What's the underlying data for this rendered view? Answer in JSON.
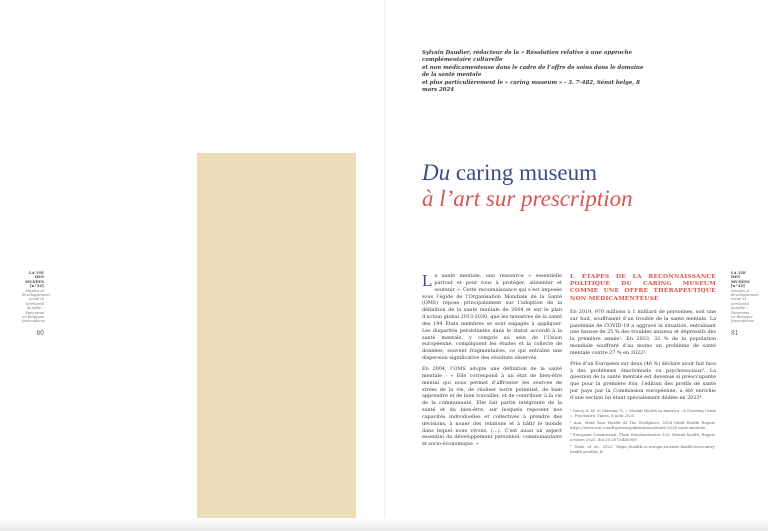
{
  "epigraph": {
    "line1": "Sylvain Daudier, rédacteur de la « Résolution relative à une approche complémentaire culturelle",
    "line2": "et non médicamenteuse dans le cadre de l’offre de soins dans le domaine de la santé mentale",
    "line3": "et plus particulièrement le « caring museum » - 3. 7-482, Sénat belge, 8 mars 2024"
  },
  "title": {
    "word_italic": "Du",
    "line1_rest": " caring museum",
    "line2": "à l’art sur prescription"
  },
  "sidebar_left": {
    "head1": "LA VIE",
    "head2": "DES",
    "head3": "MUSÉES",
    "head4": "[n°32]",
    "sub": "Musées et développement social et territorial durable – Panorama en Belgique francophone",
    "page": "80"
  },
  "sidebar_right": {
    "head1": "LA VIE",
    "head2": "DES",
    "head3": "MUSÉES",
    "head4": "[n°32]",
    "sub": "Musées et développement social et territorial durable – Panorama en Belgique francophone",
    "page": "81"
  },
  "col1": {
    "drop": "L",
    "p1": "a santé mentale, une ressource « essentielle partout et pour tous à protéger, alimenter et soutenir ». Cette reconnaissance qui s’est imposée sous l’égide de l’Organisation Mondiale de la Santé (OMS) repose principalement sur l’adoption de la définition de la santé mentale de 2004 et sur le plan d’action global 2013-2030, que les ministres de la santé des 194 États membres se sont engagés à appliquer. Les disparités persistantes dans le statut accordé à la santé mentale, y compris au sein de l’Union européenne, compliquent les études et la collecte de données, souvent fragmentaires, ce qui entraîne une dispersion significative des résultats observés.",
    "p2": "En 2004, l’OMS adopte une définition de la santé mentale : « Elle correspond à un état de bien-être mental qui nous permet d’affronter les sources de stress de la vie, de réaliser notre potentiel, de bien apprendre et de bien travailler, et de contribuer à la vie de la communauté. Elle fait partie intégrante de la santé et du bien-être, sur lesquels reposent nos capacités individuelles et collectives à prendre des décisions, à nouer des relations et à bâtir le monde dans lequel nous vivons. (…). C’est aussi un aspect essentiel du développement personnel, communautaire et socio-économique. »"
  },
  "col2": {
    "section_head": "I. ÉTAPES DE LA RECONNAISSANCE POLITIQUE DU CARING MUSEUM COMME UNE OFFRE THÉRAPEUTIQUE NON MÉDICAMENTEUSE",
    "p1": "En 2019, 970 millions à 1 milliard de personnes, soit une sur huit, souffraient d’un trouble de la santé mentale. La pandémie de COVID-19 a aggravé la situation, entraînant une hausse de 25 % des troubles anxieux et dépressifs dès la première année¹. En 2023, 32 % de la population mondiale souffrent d’au moins un problème de santé mentale contre 27 % en 2022².",
    "p2": "Près d’un Européen sur deux (46 %) déclare avoir fait face à des problèmes émotionnels ou psychosociaux³. La question de la santé mentale est devenue si préoccupante que pour la première fois, l’édition des profils de santé par pays par la Commission européenne, a été enrichie d’une section lui étant spécialement dédiée en 2023⁴.",
    "fn1": "¹ Darcy A. M. et Mariano T., « Mental Health in America : A Growing Crisis », Psychiatric Times, 8 août 2021.",
    "fn2": "² Aon, Mind Your Health At The Workplace, 2024 Mind Health Report. https://www.aon.com/fr/presse/publications/etude-2024-sante-mentale",
    "fn3": "³ European Commission, Flash Eurobarometer 530, Mental health, Report, octobre 2023, doi:10.2875/485959",
    "fn4": "⁴ State of eu, 2023, https://health.ec.europa.eu/state-health-eu/country-health-profiles_fr"
  }
}
